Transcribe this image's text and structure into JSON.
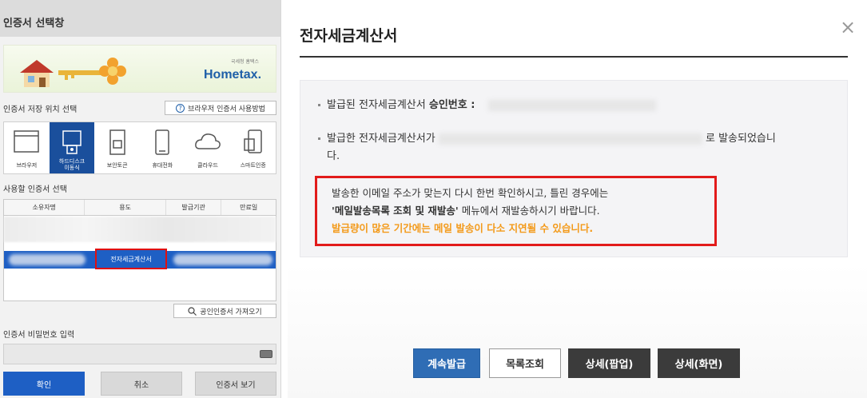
{
  "cert_window": {
    "title": "인증서 선택창",
    "logo_small": "국세청 홈택스",
    "logo": "Hometax.",
    "storage_label": "인증서 저장 위치 선택",
    "help_button": "브라우저 인증서 사용방법",
    "locations": [
      {
        "label": "브라우저",
        "icon": "browser-icon",
        "selected": false
      },
      {
        "label": "하드디스크\n이동식",
        "icon": "usb-drive-icon",
        "selected": true
      },
      {
        "label": "보안토큰",
        "icon": "security-token-icon",
        "selected": false
      },
      {
        "label": "휴대전화",
        "icon": "mobile-phone-icon",
        "selected": false
      },
      {
        "label": "클라우드",
        "icon": "cloud-icon",
        "selected": false
      },
      {
        "label": "스마트인증",
        "icon": "smart-auth-icon",
        "selected": false
      }
    ],
    "select_label": "사용할 인증서 선택",
    "columns": [
      "소유자명",
      "용도",
      "발급기관",
      "만료일"
    ],
    "selected_row_usage": "전자세금계산서",
    "import_button": "공인인증서 가져오기",
    "password_label": "인증서 비밀번호 입력",
    "buttons": {
      "ok": "확인",
      "cancel": "취소",
      "view": "인증서 보기"
    },
    "accent_color": "#1e5fc4"
  },
  "dialog": {
    "title": "전자세금계산서",
    "close": "×",
    "line1_prefix": "발급된 전자세금계산서 ",
    "line1_bold": "승인번호 :",
    "line2_prefix": "발급한 전자세금계산서가",
    "line2_suffix": "로 발송되었습니",
    "line2_wrap": "다.",
    "notice_line1": "발송한 이메일 주소가 맞는지 다시 한번 확인하시고, 틀린 경우에는",
    "notice_line2_bold": "'메일발송목록 조회 및 재발송'",
    "notice_line2_rest": " 메뉴에서 재발송하시기 바랍니다.",
    "notice_line3": "발급량이 많은 기간에는 메일 발송이 다소 지연될 수 있습니다.",
    "buttons": {
      "continue": "계속발급",
      "list": "목록조회",
      "detail_popup": "상세(팝업)",
      "detail_screen": "상세(화면)"
    },
    "highlight_color": "#e21b1b",
    "warning_color": "#f39a1a"
  }
}
